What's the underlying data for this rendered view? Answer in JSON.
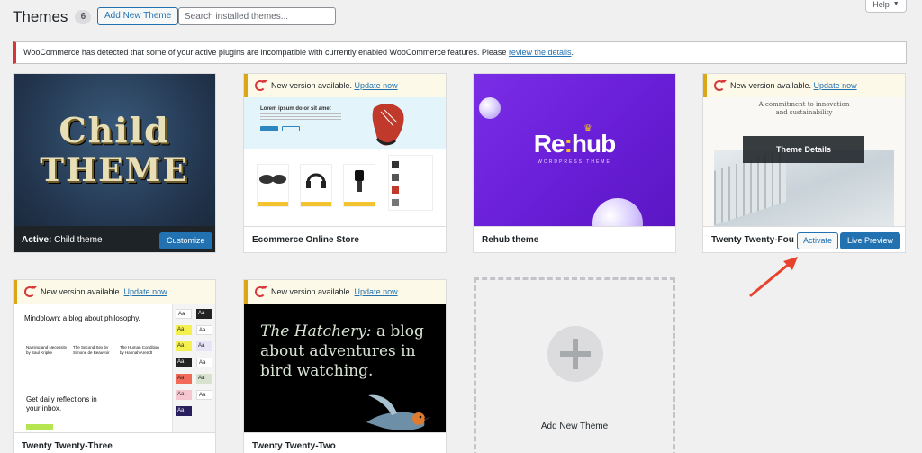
{
  "header": {
    "title": "Themes",
    "count": "6",
    "add_new_label": "Add New Theme",
    "search_placeholder": "Search installed themes...",
    "help_label": "Help"
  },
  "notice": {
    "text": "WooCommerce has detected that some of your active plugins are incompatible with currently enabled WooCommerce features. Please ",
    "link": "review the details",
    "tail": "."
  },
  "update_notice": {
    "text": "New version available. ",
    "link": "Update now"
  },
  "themes": {
    "child": {
      "shot_line1": "Child",
      "shot_line2": "THEME",
      "active_label": "Active:",
      "name": "Child theme",
      "customize_label": "Customize"
    },
    "ecommerce": {
      "name": "Ecommerce Online Store",
      "hero_heading": "Lorem ipsum dolor sit amet"
    },
    "rehub": {
      "name": "Rehub theme",
      "logo_a": "Re",
      "logo_colon": ":",
      "logo_b": "hub",
      "logo_sub": "WORDPRESS THEME"
    },
    "tt4": {
      "name": "Twenty Twenty-Fou",
      "head": "A commitment to innovation and sustainability",
      "details_label": "Theme Details",
      "activate_label": "Activate",
      "live_preview_label": "Live Preview"
    },
    "tt3": {
      "name": "Twenty Twenty-Three",
      "shot_title": "Mindblown: a blog about philosophy.",
      "col1": "Naming and Necessity by Saul Kripke",
      "col2": "The Second Sex by Simone de Beauvoir",
      "col3": "The Human Condition by Hannah Arendt",
      "cta": "Get daily reflections in your inbox.",
      "swatch": "Aa"
    },
    "tt2": {
      "name": "Twenty Twenty-Two",
      "shot_em": "The Hatchery:",
      "shot_rest": " a blog about adventures in bird watching."
    }
  },
  "add_new_tile": {
    "label": "Add New Theme"
  },
  "colors": {
    "accent": "#2271b1",
    "error": "#d63638",
    "warning": "#dba617",
    "arrow": "#e8412c"
  }
}
